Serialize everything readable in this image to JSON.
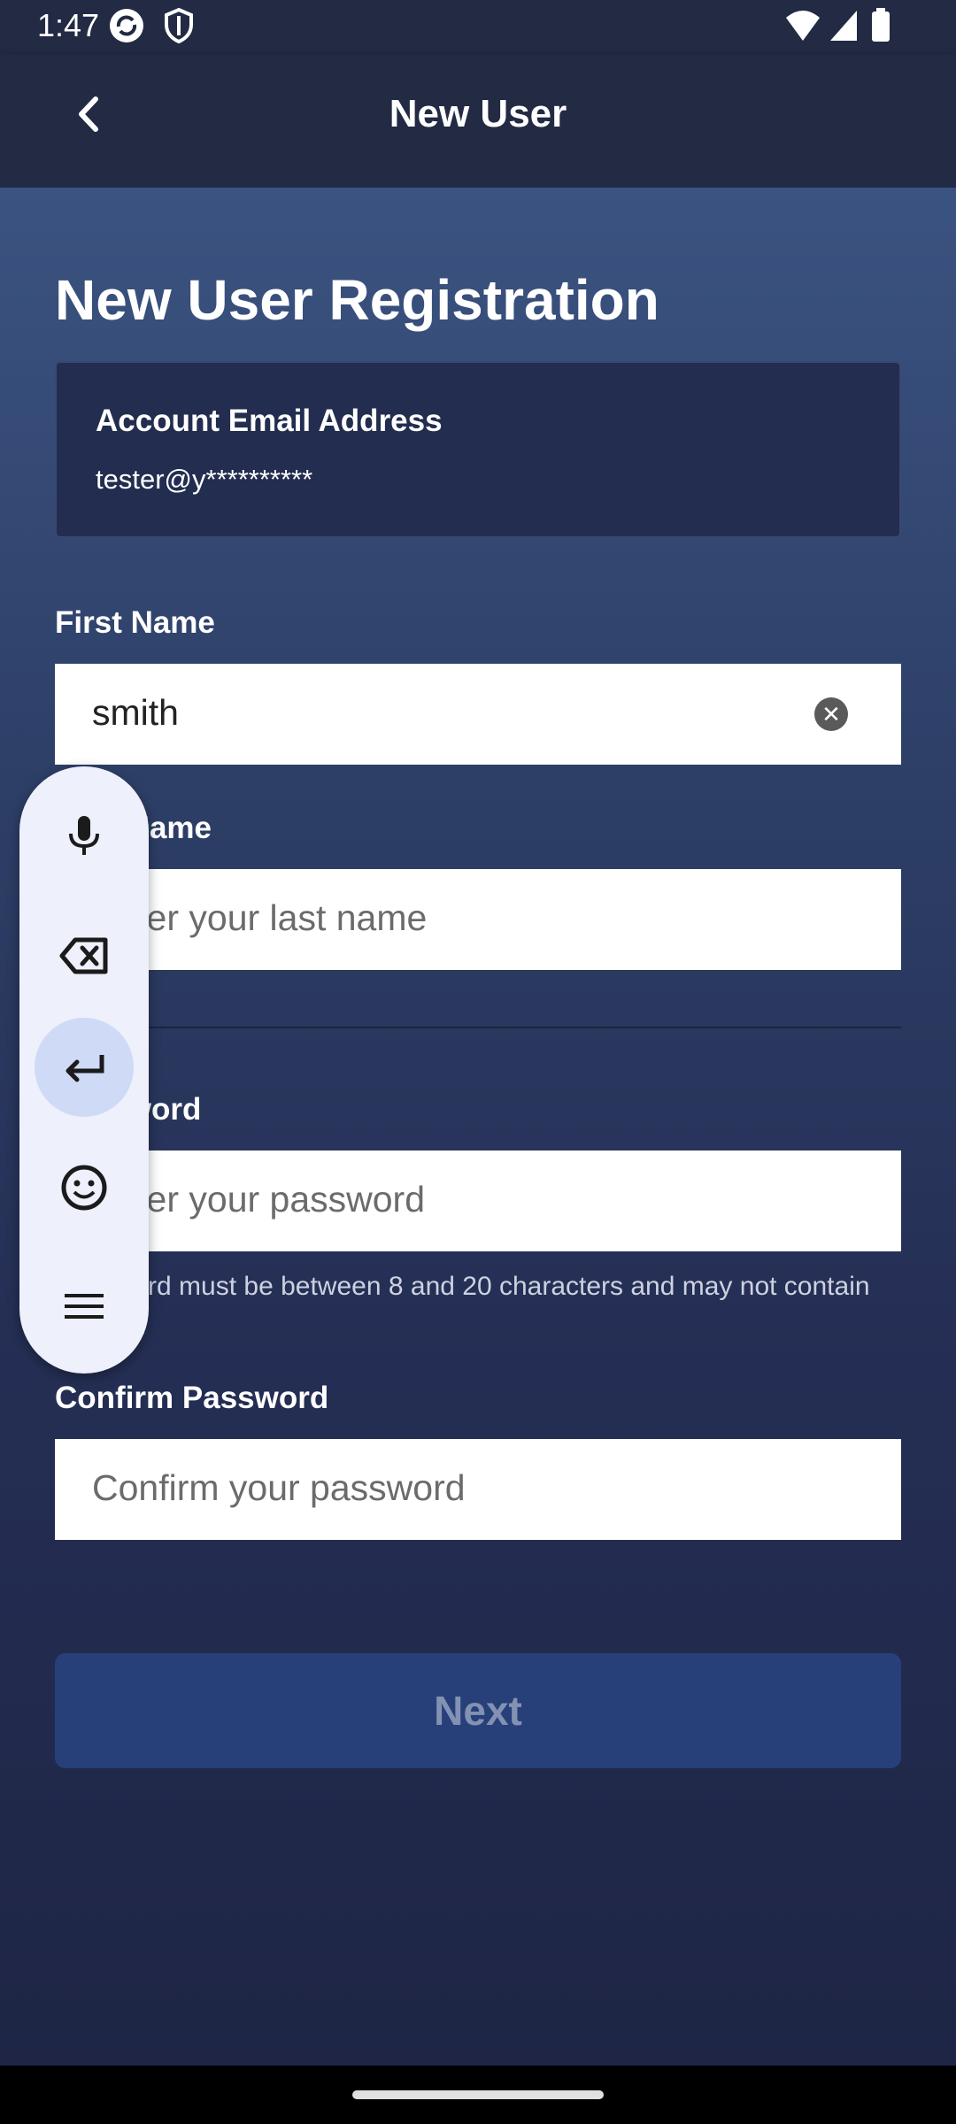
{
  "status_bar": {
    "time": "1:47"
  },
  "app_bar": {
    "title": "New User"
  },
  "page": {
    "heading": "New User Registration"
  },
  "email_card": {
    "label": "Account Email Address",
    "value": "tester@y**********"
  },
  "first_name": {
    "label": "First Name",
    "value": "smith"
  },
  "last_name": {
    "label": "Last Name",
    "placeholder": "Enter your last name"
  },
  "password": {
    "label": "Password",
    "placeholder": "Enter your password",
    "hint": "Password must be between 8 and 20 characters and may not contain spaces."
  },
  "confirm_password": {
    "label": "Confirm Password",
    "placeholder": "Confirm your password"
  },
  "next_button": {
    "label": "Next"
  },
  "floating_toolbar": {
    "icons": [
      "mic-icon",
      "backspace-icon",
      "enter-icon",
      "emoji-icon",
      "menu-icon"
    ]
  },
  "colors": {
    "background_top": "#3b5381",
    "background_bottom": "#1e2545",
    "button": "#27407a"
  }
}
